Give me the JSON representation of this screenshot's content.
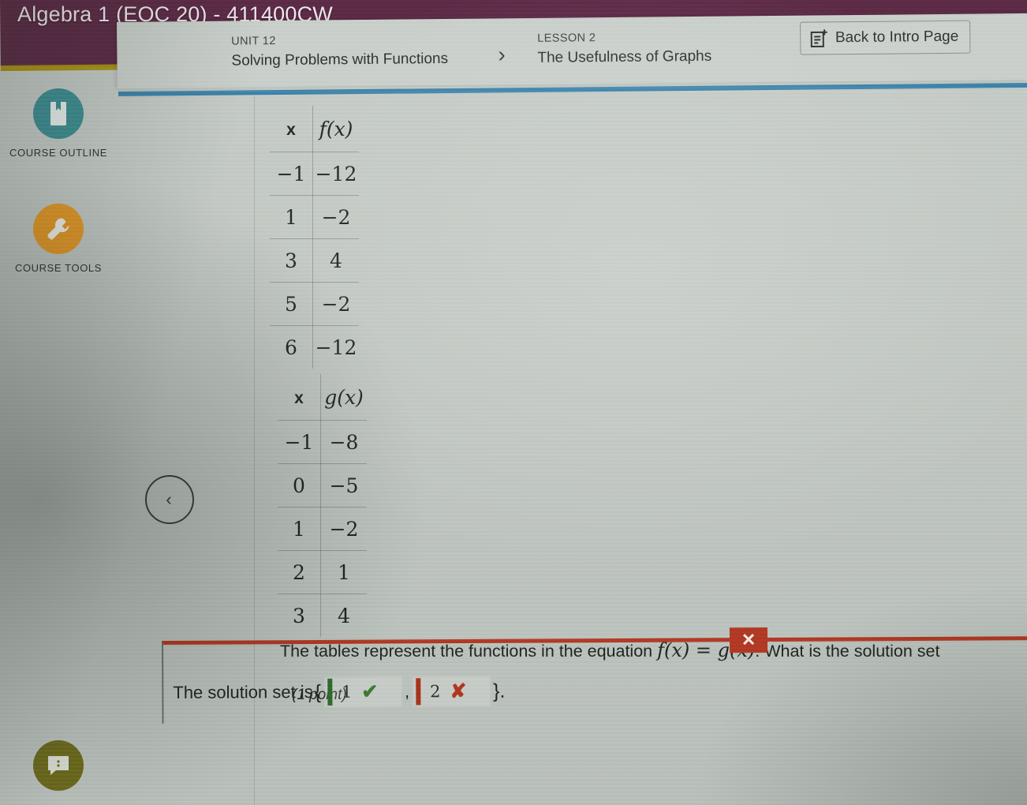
{
  "header": {
    "course_title": "Algebra 1 (EOC 20) - 411400CW",
    "unit_eyebrow": "UNIT 12",
    "unit_title": "Solving Problems with Functions",
    "lesson_eyebrow": "LESSON 2",
    "lesson_title": "The Usefulness of Graphs",
    "chevron": "›",
    "back_button_label": "Back to Intro Page",
    "back_button_icon": "note-plus-icon",
    "banner_color": "#5d2b46",
    "accent_color": "#a99415",
    "rule_color": "#3f84ab"
  },
  "rail": {
    "items": [
      {
        "label": "COURSE OUTLINE",
        "icon": "book-bookmark-icon",
        "color": "#3f8f93"
      },
      {
        "label": "COURSE TOOLS",
        "icon": "wrench-icon",
        "color": "#e59a28"
      },
      {
        "label": "",
        "icon": "speech-bubble-icon",
        "color": "#6c6a1e"
      }
    ]
  },
  "nav": {
    "prev_icon": "chevron-left-icon",
    "prev_glyph": "‹"
  },
  "tables": [
    {
      "name": "f-table",
      "headers": [
        "x",
        "f(x)"
      ],
      "header_x": "x",
      "header_fn": "f",
      "rows": [
        {
          "x": "−1",
          "y": "−12"
        },
        {
          "x": "1",
          "y": "−2"
        },
        {
          "x": "3",
          "y": "4"
        },
        {
          "x": "5",
          "y": "−2"
        },
        {
          "x": "6",
          "y": "−12"
        }
      ]
    },
    {
      "name": "g-table",
      "headers": [
        "x",
        "g(x)"
      ],
      "header_x": "x",
      "header_fn": "g",
      "rows": [
        {
          "x": "−1",
          "y": "−8"
        },
        {
          "x": "0",
          "y": "−5"
        },
        {
          "x": "1",
          "y": "−2"
        },
        {
          "x": "2",
          "y": "1"
        },
        {
          "x": "3",
          "y": "4"
        }
      ]
    }
  ],
  "question": {
    "text_before": "The tables represent the functions in the equation ",
    "equation_f": "f",
    "equation_paren1": "(x)",
    "equation_eq": " = ",
    "equation_g": "g",
    "equation_paren2": "(x)",
    "text_after": ". What is the solution set",
    "points": "(1 point)"
  },
  "answer": {
    "lead_text": "The solution set is",
    "open_brace": "{",
    "close_brace": "}.",
    "comma": ",",
    "period": ".",
    "fields": [
      {
        "value": "1",
        "mark": "✔",
        "state": "correct",
        "color": "#3f7a33"
      },
      {
        "value": "2",
        "mark": "✘",
        "state": "incorrect",
        "color": "#b0371f"
      }
    ],
    "badge_glyph": "✕",
    "badge_color": "#b13a24",
    "border_color": "#b13a24"
  }
}
